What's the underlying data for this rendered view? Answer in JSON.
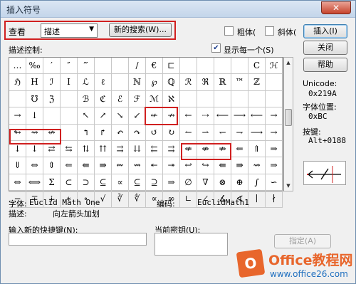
{
  "window": {
    "title": "插入符号",
    "close_icon": "✕"
  },
  "toolbar": {
    "view_label": "查看",
    "view_select_value": "描述",
    "view_select_arrow": "▼",
    "new_search_label": "新的搜索(W)...",
    "bold_label": "粗体(",
    "italic_label": "斜体(",
    "insert_label": "插入(I)"
  },
  "buttons": {
    "close_label": "关闭",
    "help_label": "帮助",
    "assign_label": "指定(A)"
  },
  "panel": {
    "description_control_label": "描述控制:",
    "show_each_label": "显示每一个(S)",
    "show_each_checked": true
  },
  "grid_cells": [
    "…",
    "‰",
    "′",
    "″",
    "‴",
    "",
    "",
    "/",
    "€",
    "⊏",
    "",
    "",
    "",
    "",
    "C",
    "ℋ",
    "ℌ",
    "H",
    "ℐ",
    "I",
    "ℒ",
    "ℓ",
    "",
    "ℕ",
    "℘",
    "ℚ",
    "ℛ",
    "ℜ",
    "ℝ",
    "™",
    "ℤ",
    "",
    "",
    "℧",
    "ℨ",
    "",
    "ℬ",
    "ℭ",
    "ℰ",
    "ℱ",
    "ℳ",
    "ℵ",
    "",
    "",
    "",
    "",
    "",
    "",
    "→",
    "↓",
    "",
    "",
    "↖",
    "↗",
    "↘",
    "↙",
    "↚",
    "↛",
    "←",
    "⇢",
    "⟵",
    "⟶",
    "⟵",
    "→",
    "↬",
    "⇝",
    "↮",
    "",
    "↰",
    "↱",
    "↶",
    "↷",
    "↺",
    "↻",
    "↼",
    "⇀",
    "↽",
    "⇁",
    "⟶",
    "→",
    "↓",
    "↓",
    "⇄",
    "⇆",
    "⇅",
    "⇈",
    "⇉",
    "⇊",
    "⇇",
    "⇉",
    "⇍",
    "⇎",
    "⇏",
    "⇐",
    "⇑",
    "⇒",
    "⇓",
    "⇔",
    "⇕",
    "⇐",
    "⇚",
    "⇛",
    "⇜",
    "⇝",
    "↞",
    "↠",
    "↩",
    "↪",
    "⇚",
    "⇛",
    "⇝",
    "⇒",
    "⇔",
    "⟺",
    "Σ",
    "⊂",
    "⊃",
    "⊆",
    "∝",
    "⊆",
    "⊇",
    "⇒",
    "∅",
    "∇",
    "⊗",
    "⊕",
    "∫",
    "∽",
    "−",
    "∓",
    "∔",
    "∗",
    "∘",
    "√",
    "∛",
    "∜",
    "∝",
    "∞",
    "∟",
    "∠",
    "∡",
    "∢",
    "∣",
    "∤"
  ],
  "info": {
    "unicode_label": "Unicode:",
    "unicode_value": "0x219A",
    "char_pos_label": "字体位置:",
    "char_pos_value": "0xBC",
    "keystroke_label": "按键:",
    "keystroke_value": "Alt+0188",
    "font_label": "字体:",
    "font_value": "Euclid Math One",
    "encoding_label": "编码:",
    "encoding_value": "EuclidMath1",
    "desc_label": "描述:",
    "desc_value": "向左箭头加划"
  },
  "shortcut": {
    "new_shortcut_label": "输入新的快捷键(N):",
    "new_shortcut_value": "",
    "current_key_label": "当前密钥(U):",
    "current_key_value": ""
  },
  "watermark": {
    "brand": "Office教程网",
    "url": "www.office26.com",
    "icon_glyph": "O"
  }
}
